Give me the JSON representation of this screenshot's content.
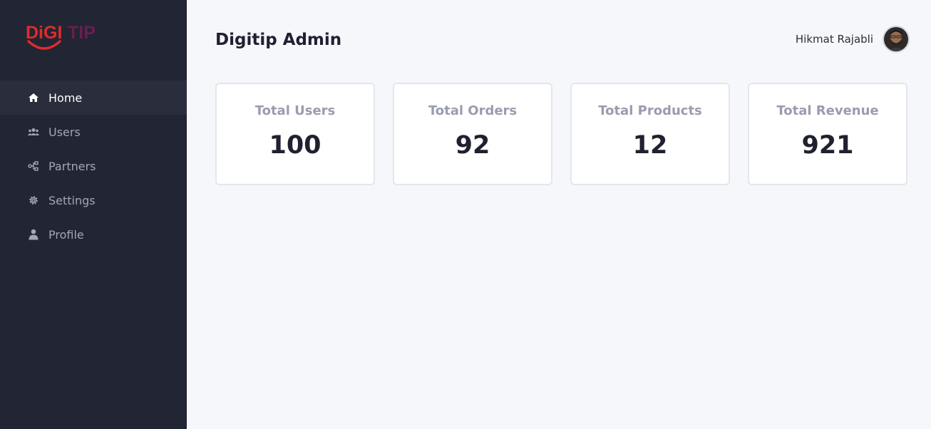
{
  "brand": {
    "logo_text_main": "DiGI",
    "logo_text_accent": "TIP",
    "colors": {
      "red": "#e02b2b",
      "purple": "#6b1e4f",
      "sidebar_bg": "#222533",
      "page_bg": "#f6f7fb"
    }
  },
  "sidebar": {
    "items": [
      {
        "label": "Home",
        "icon": "home-icon",
        "active": true
      },
      {
        "label": "Users",
        "icon": "users-icon",
        "active": false
      },
      {
        "label": "Partners",
        "icon": "partners-icon",
        "active": false
      },
      {
        "label": "Settings",
        "icon": "gear-icon",
        "active": false
      },
      {
        "label": "Profile",
        "icon": "user-icon",
        "active": false
      }
    ]
  },
  "header": {
    "title": "Digitip Admin",
    "user_name": "Hikmat Rajabli"
  },
  "stats": [
    {
      "title": "Total Users",
      "value": "100"
    },
    {
      "title": "Total Orders",
      "value": "92"
    },
    {
      "title": "Total Products",
      "value": "12"
    },
    {
      "title": "Total Revenue",
      "value": "921"
    }
  ]
}
